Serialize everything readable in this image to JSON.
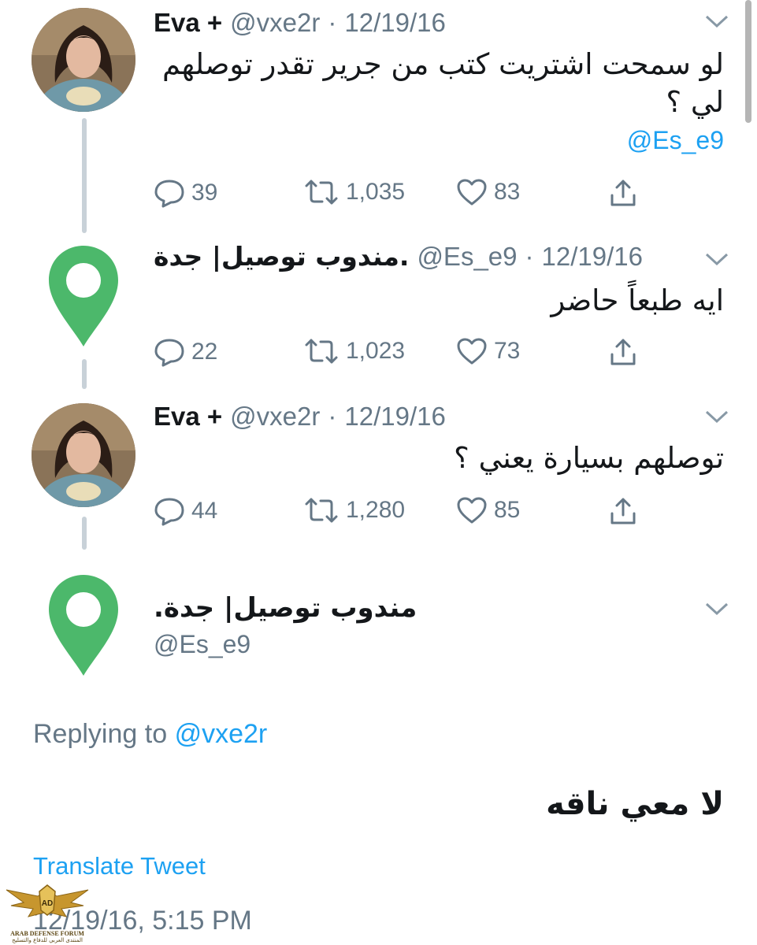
{
  "tweets": [
    {
      "name": "Eva +",
      "handle": "@vxe2r",
      "separator": "·",
      "date": "12/19/16",
      "text_line1": "لو سمحت اشتريت كتب من جرير تقدر توصلهم",
      "text_line2": "لي ؟",
      "mention": "@Es_e9",
      "replies": "39",
      "retweets": "1,035",
      "likes": "83"
    },
    {
      "name": "مندوب توصيل| جدة.",
      "handle": "@Es_e9",
      "separator": "·",
      "date": "12/19/16",
      "text": "ايه طبعاً حاضر",
      "replies": "22",
      "retweets": "1,023",
      "likes": "73"
    },
    {
      "name": "Eva +",
      "handle": "@vxe2r",
      "separator": "·",
      "date": "12/19/16",
      "text": "توصلهم بسيارة يعني ؟",
      "replies": "44",
      "retweets": "1,280",
      "likes": "85"
    }
  ],
  "main_tweet": {
    "name": "مندوب توصيل| جدة.",
    "handle": "@Es_e9",
    "replying_label": "Replying to",
    "replying_handle": "@vxe2r",
    "text": "لا معي ناقه",
    "translate": "Translate Tweet",
    "timestamp": "12/19/16, 5:15 PM"
  },
  "watermark": {
    "title": "ARAB DEFENSE FORUM",
    "subtitle": "المنتدى العربي للدفاع والتسليح"
  },
  "colors": {
    "link": "#1da1f2",
    "secondary": "#657786",
    "pin": "#4cb86b",
    "thread": "#c8d1d8"
  }
}
